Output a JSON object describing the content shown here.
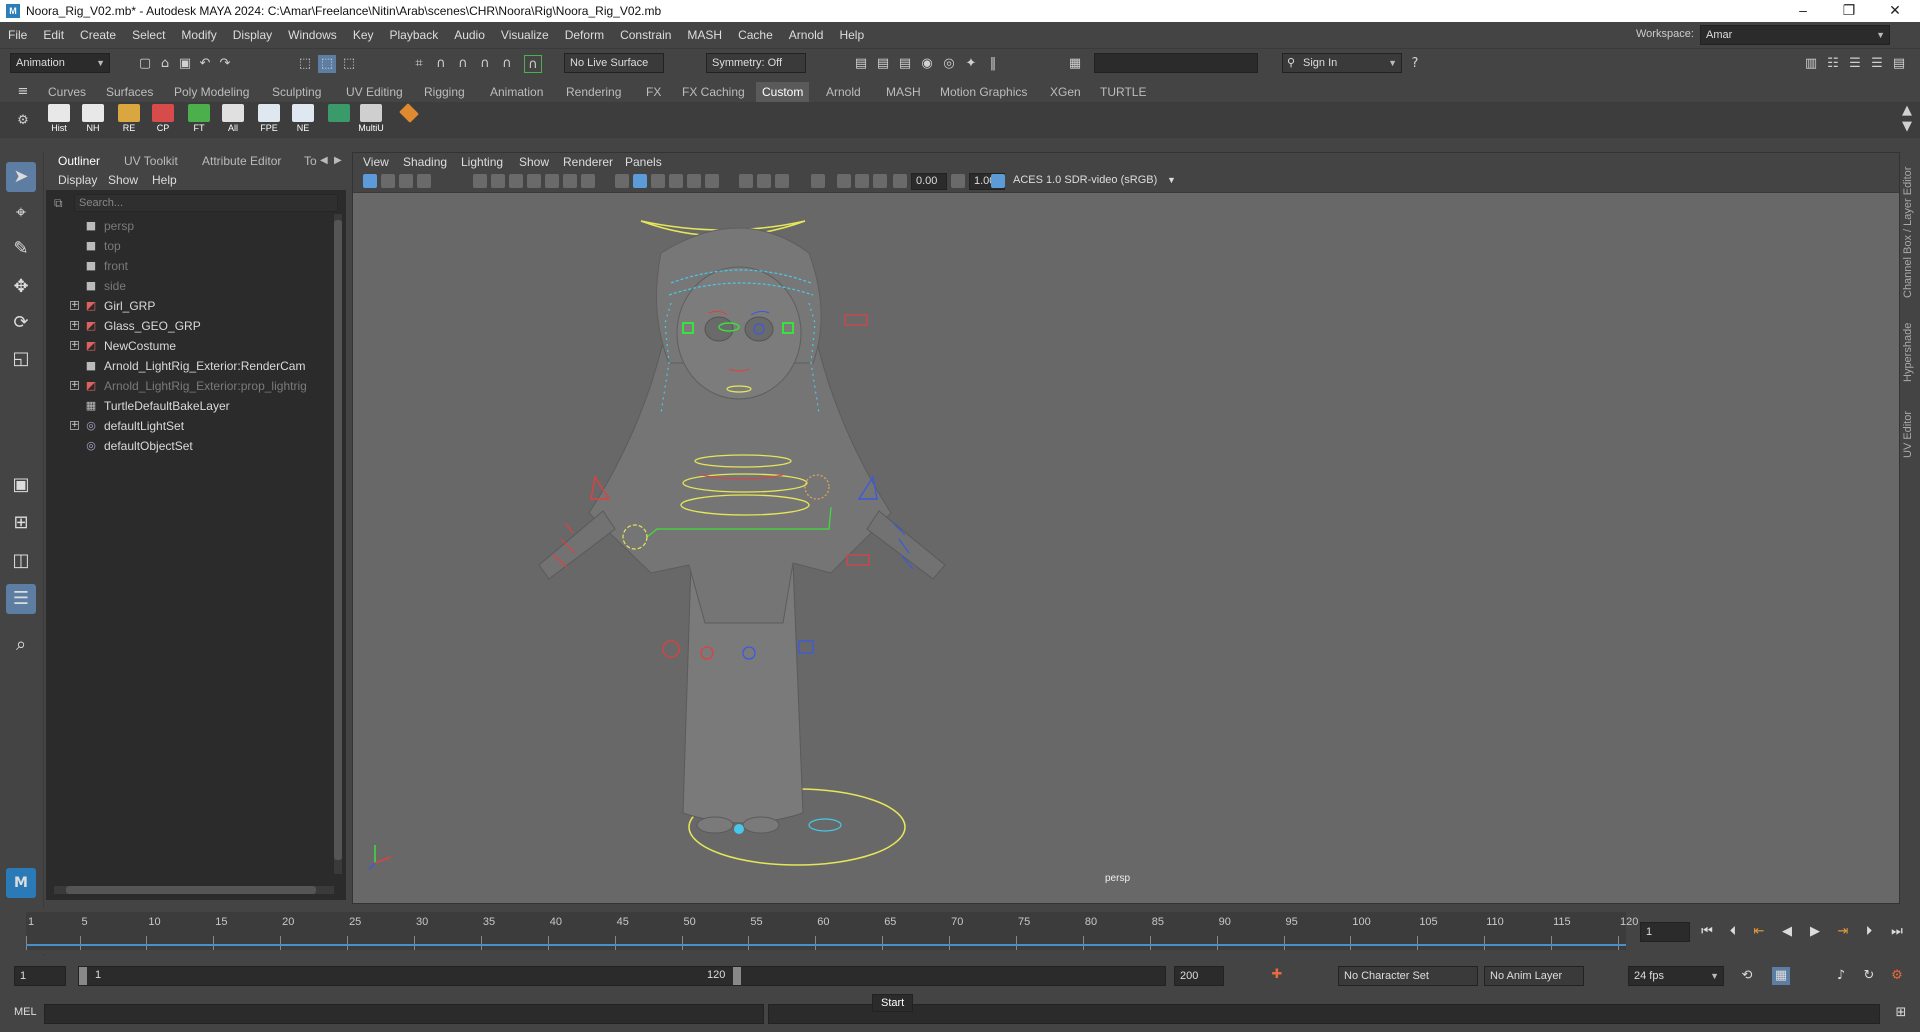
{
  "window": {
    "title": "Noora_Rig_V02.mb* - Autodesk MAYA 2024: C:\\Amar\\Freelance\\Nitin\\Arab\\scenes\\CHR\\Noora\\Rig\\Noora_Rig_V02.mb",
    "controls": [
      "–",
      "❐",
      "✕"
    ]
  },
  "menubar": {
    "items": [
      "File",
      "Edit",
      "Create",
      "Select",
      "Modify",
      "Display",
      "Windows",
      "Key",
      "Playback",
      "Audio",
      "Visualize",
      "Deform",
      "Constrain",
      "MASH",
      "Cache",
      "Arnold",
      "Help"
    ],
    "workspace_label": "Workspace:",
    "workspace_value": "Amar"
  },
  "statusline": {
    "menuset": "Animation",
    "live_surface": "No Live Surface",
    "symmetry": "Symmetry: Off",
    "sign_in": "Sign In"
  },
  "shelf": {
    "tabs": [
      "Curves",
      "Surfaces",
      "Poly Modeling",
      "Sculpting",
      "UV Editing",
      "Rigging",
      "Animation",
      "Rendering",
      "FX",
      "FX Caching",
      "Custom",
      "Arnold",
      "MASH",
      "Motion Graphics",
      "XGen",
      "TURTLE"
    ],
    "active_tab": "Custom",
    "buttons": [
      {
        "label": "Hist",
        "color": "#e8e8e8"
      },
      {
        "label": "NH",
        "color": "#e8e8e8"
      },
      {
        "label": "RE",
        "color": "#d9a640"
      },
      {
        "label": "CP",
        "color": "#d84b4b"
      },
      {
        "label": "FT",
        "color": "#4bb04b"
      },
      {
        "label": "All",
        "color": "#e0e0e0"
      },
      {
        "label": "FPE",
        "color": "#dfe8f0"
      },
      {
        "label": "NE",
        "color": "#dfe8f0"
      },
      {
        "label": "",
        "color": "#3a9a6a"
      },
      {
        "label": "MultiU",
        "color": "#cfcfcf"
      },
      {
        "label": "",
        "color": "#e08a30"
      }
    ]
  },
  "outliner": {
    "tabs": [
      "Outliner",
      "UV Toolkit",
      "Attribute Editor",
      "To"
    ],
    "menu": [
      "Display",
      "Show",
      "Help"
    ],
    "search_placeholder": "Search...",
    "items": [
      {
        "label": "persp",
        "icon": "camera-icon",
        "expandable": false,
        "dim": true
      },
      {
        "label": "top",
        "icon": "camera-icon",
        "expandable": false,
        "dim": true
      },
      {
        "label": "front",
        "icon": "camera-icon",
        "expandable": false,
        "dim": true
      },
      {
        "label": "side",
        "icon": "camera-icon",
        "expandable": false,
        "dim": true
      },
      {
        "label": "Girl_GRP",
        "icon": "group-icon",
        "expandable": true,
        "dim": false
      },
      {
        "label": "Glass_GEO_GRP",
        "icon": "group-icon",
        "expandable": true,
        "dim": false
      },
      {
        "label": "NewCostume",
        "icon": "group-icon",
        "expandable": true,
        "dim": false
      },
      {
        "label": "Arnold_LightRig_Exterior:RenderCam",
        "icon": "camera-icon",
        "expandable": false,
        "dim": false
      },
      {
        "label": "Arnold_LightRig_Exterior:prop_lightrig",
        "icon": "group-icon",
        "expandable": true,
        "dim": true
      },
      {
        "label": "TurtleDefaultBakeLayer",
        "icon": "layer-icon",
        "expandable": false,
        "dim": false
      },
      {
        "label": "defaultLightSet",
        "icon": "set-icon",
        "expandable": true,
        "dim": false
      },
      {
        "label": "defaultObjectSet",
        "icon": "set-icon",
        "expandable": false,
        "dim": false
      }
    ]
  },
  "viewport": {
    "menu": [
      "View",
      "Shading",
      "Lighting",
      "Show",
      "Renderer",
      "Panels"
    ],
    "exposure": "0.00",
    "gamma": "1.00",
    "color_space": "ACES 1.0 SDR-video (sRGB)",
    "camera_label": "persp"
  },
  "right_panel": {
    "tabs": [
      "Channel Box / Layer Editor",
      "Hypershade",
      "UV Editor"
    ]
  },
  "timeslider": {
    "ticks": [
      "1",
      "5",
      "10",
      "15",
      "20",
      "25",
      "30",
      "35",
      "40",
      "45",
      "50",
      "55",
      "60",
      "65",
      "70",
      "75",
      "80",
      "85",
      "90",
      "95",
      "100",
      "105",
      "110",
      "115",
      "120"
    ],
    "current_frame": "1"
  },
  "range": {
    "start": "1",
    "range_start": "1",
    "range_end": "120",
    "end": "200",
    "character_set": "No Character Set",
    "anim_layer": "No Anim Layer",
    "fps": "24 fps"
  },
  "cmdline": {
    "label": "MEL",
    "tooltip": "Start"
  }
}
